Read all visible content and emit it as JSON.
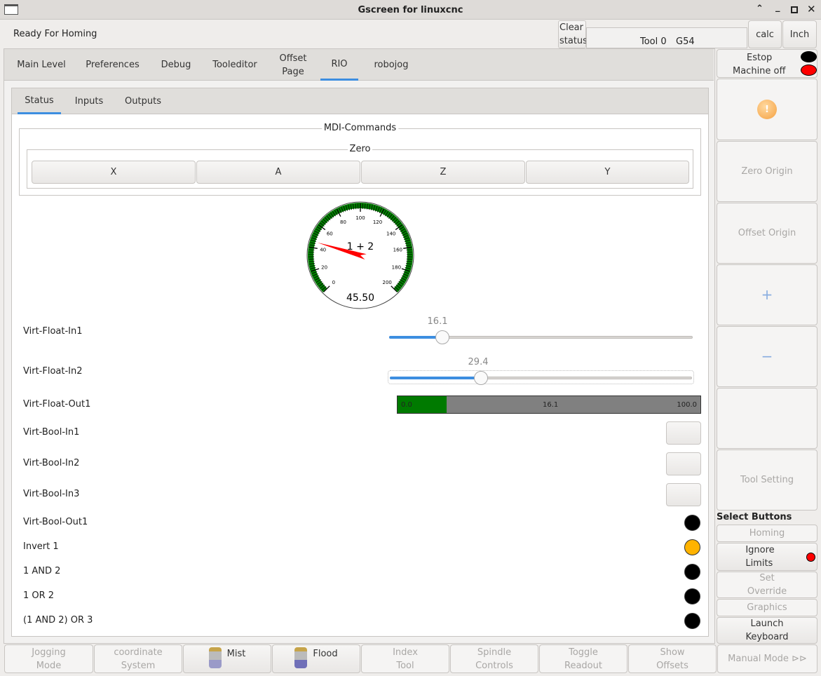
{
  "window": {
    "title": "Gscreen for linuxcnc"
  },
  "status": {
    "message": "Ready For Homing",
    "clear_label_1": "Clear",
    "clear_label_2": "status",
    "tool": "Tool 0",
    "coord": "G54",
    "calc": "calc",
    "units": "Inch"
  },
  "tabs": [
    {
      "label": "Main Level"
    },
    {
      "label": "Preferences"
    },
    {
      "label": "Debug"
    },
    {
      "label": "Tooleditor"
    },
    {
      "label": "Offset\nPage"
    },
    {
      "label": "RIO"
    },
    {
      "label": "robojog"
    }
  ],
  "subtabs": [
    {
      "label": "Status"
    },
    {
      "label": "Inputs"
    },
    {
      "label": "Outputs"
    }
  ],
  "mdi": {
    "title": "MDI-Commands",
    "zero_title": "Zero",
    "buttons": [
      "X",
      "A",
      "Z",
      "Y"
    ]
  },
  "gauge": {
    "label": "1 + 2",
    "value": 45.5,
    "value_text": "45.50",
    "min": 0,
    "max": 200,
    "ticks": [
      "0",
      "20",
      "40",
      "60",
      "80",
      "100",
      "120",
      "140",
      "160",
      "180",
      "200"
    ],
    "arc_color": "#008000",
    "needle_color": "#ff0000"
  },
  "rows": {
    "float_in1": {
      "label": "Virt-Float-In1",
      "value": 16.1,
      "value_text": "16.1",
      "max": 100
    },
    "float_in2": {
      "label": "Virt-Float-In2",
      "value": 29.4,
      "value_text": "29.4",
      "max": 100
    },
    "float_out1": {
      "label": "Virt-Float-Out1",
      "min_text": "0.0",
      "value_text": "16.1",
      "max_text": "100.0",
      "fraction": 0.161
    },
    "bool_in": [
      {
        "label": "Virt-Bool-In1"
      },
      {
        "label": "Virt-Bool-In2"
      },
      {
        "label": "Virt-Bool-In3"
      }
    ],
    "leds": [
      {
        "label": "Virt-Bool-Out1",
        "color": "#000000"
      },
      {
        "label": "Invert 1",
        "color": "#ffb300"
      },
      {
        "label": "1 AND 2",
        "color": "#000000"
      },
      {
        "label": "1 OR 2",
        "color": "#000000"
      },
      {
        "label": "(1 AND 2) OR 3",
        "color": "#000000"
      }
    ]
  },
  "right": {
    "estop": "Estop",
    "machine": "Machine off",
    "zero_origin": "Zero Origin",
    "offset_origin": "Offset Origin",
    "plus": "+",
    "minus": "−",
    "tool_setting": "Tool Setting",
    "select_title": "Select Buttons",
    "homing": "Homing",
    "ignore_limits": "Ignore\nLimits",
    "set_override": "Set\nOverride",
    "graphics": "Graphics",
    "launch_keyboard": "Launch\nKeyboard"
  },
  "bottom": [
    {
      "label": "Jogging\nMode"
    },
    {
      "label": "coordinate\nSystem"
    },
    {
      "label": "Mist"
    },
    {
      "label": "Flood"
    },
    {
      "label": "Index\nTool"
    },
    {
      "label": "Spindle\nControls"
    },
    {
      "label": "Toggle\nReadout"
    },
    {
      "label": "Show\nOffsets"
    },
    {
      "label": "Manual Mode ⊳⊳"
    }
  ]
}
